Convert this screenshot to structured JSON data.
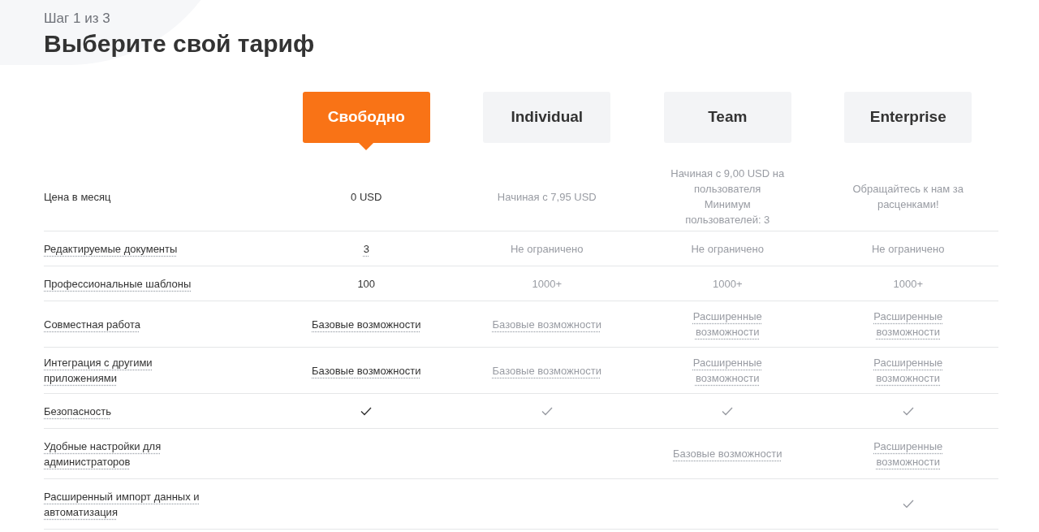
{
  "step": "Шаг 1 из 3",
  "title": "Выберите свой тариф",
  "plans": [
    {
      "name": "Свободно",
      "selected": true
    },
    {
      "name": "Individual",
      "selected": false
    },
    {
      "name": "Team",
      "selected": false
    },
    {
      "name": "Enterprise",
      "selected": false
    }
  ],
  "rows": [
    {
      "label": "Цена в месяц",
      "dotted": false,
      "cells": [
        {
          "kind": "text",
          "text": "0 USD",
          "dotted": false
        },
        {
          "kind": "text",
          "text": "Начиная с 7,95 USD",
          "dotted": false
        },
        {
          "kind": "text",
          "text": "Начиная с 9,00 USD на пользователя Минимум пользователей: 3",
          "dotted": false
        },
        {
          "kind": "text",
          "text": "Обращайтесь к нам за расценками!",
          "dotted": false
        }
      ]
    },
    {
      "label": "Редактируемые документы",
      "dotted": true,
      "cells": [
        {
          "kind": "text",
          "text": "3",
          "dotted": true
        },
        {
          "kind": "text",
          "text": "Не ограничено",
          "dotted": false
        },
        {
          "kind": "text",
          "text": "Не ограничено",
          "dotted": false
        },
        {
          "kind": "text",
          "text": "Не ограничено",
          "dotted": false
        }
      ]
    },
    {
      "label": "Профессиональные шаблоны",
      "dotted": true,
      "cells": [
        {
          "kind": "text",
          "text": "100",
          "dotted": false
        },
        {
          "kind": "text",
          "text": "1000+",
          "dotted": false
        },
        {
          "kind": "text",
          "text": "1000+",
          "dotted": false
        },
        {
          "kind": "text",
          "text": "1000+",
          "dotted": false
        }
      ]
    },
    {
      "label": "Совместная работа",
      "dotted": true,
      "cells": [
        {
          "kind": "text",
          "text": "Базовые возможности",
          "dotted": true
        },
        {
          "kind": "text",
          "text": "Базовые возможности",
          "dotted": true
        },
        {
          "kind": "text",
          "text": "Расширенные возможности",
          "dotted": true
        },
        {
          "kind": "text",
          "text": "Расширенные возможности",
          "dotted": true
        }
      ]
    },
    {
      "label": "Интеграция с другими приложениями",
      "dotted": true,
      "cells": [
        {
          "kind": "text",
          "text": "Базовые возможности",
          "dotted": true
        },
        {
          "kind": "text",
          "text": "Базовые возможности",
          "dotted": true
        },
        {
          "kind": "text",
          "text": "Расширенные возможности",
          "dotted": true
        },
        {
          "kind": "text",
          "text": "Расширенные возможности",
          "dotted": true
        }
      ]
    },
    {
      "label": "Безопасность",
      "dotted": true,
      "cells": [
        {
          "kind": "check"
        },
        {
          "kind": "check"
        },
        {
          "kind": "check"
        },
        {
          "kind": "check"
        }
      ]
    },
    {
      "label": "Удобные настройки для администраторов",
      "dotted": true,
      "cells": [
        {
          "kind": "empty"
        },
        {
          "kind": "empty"
        },
        {
          "kind": "text",
          "text": "Базовые возможности",
          "dotted": true
        },
        {
          "kind": "text",
          "text": "Расширенные возможности",
          "dotted": true
        }
      ]
    },
    {
      "label": "Расширенный импорт данных и автоматизация",
      "dotted": true,
      "cells": [
        {
          "kind": "empty"
        },
        {
          "kind": "empty"
        },
        {
          "kind": "empty"
        },
        {
          "kind": "check"
        }
      ]
    }
  ]
}
